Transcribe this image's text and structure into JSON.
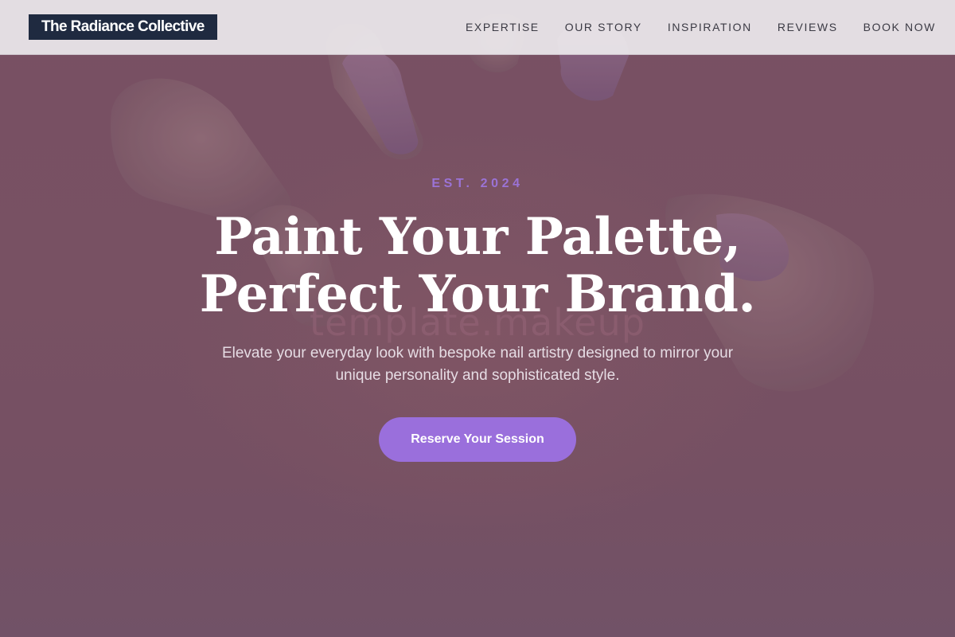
{
  "header": {
    "brand": "The Radiance Collective",
    "nav": [
      {
        "label": "EXPERTISE"
      },
      {
        "label": "OUR STORY"
      },
      {
        "label": "INSPIRATION"
      },
      {
        "label": "REVIEWS"
      },
      {
        "label": "BOOK NOW"
      }
    ]
  },
  "hero": {
    "eyebrow": "EST. 2024",
    "headline_line1": "Paint Your Palette,",
    "headline_line2": "Perfect Your Brand.",
    "watermark": "template.makeup",
    "subtitle": "Elevate your everyday look with bespoke nail artistry designed to mirror your unique personality and sophisticated style.",
    "cta_label": "Reserve Your Session"
  },
  "colors": {
    "accent": "#9a6fdc",
    "brand_dark": "#1f2a40",
    "hero_tint": "#7a5566"
  }
}
